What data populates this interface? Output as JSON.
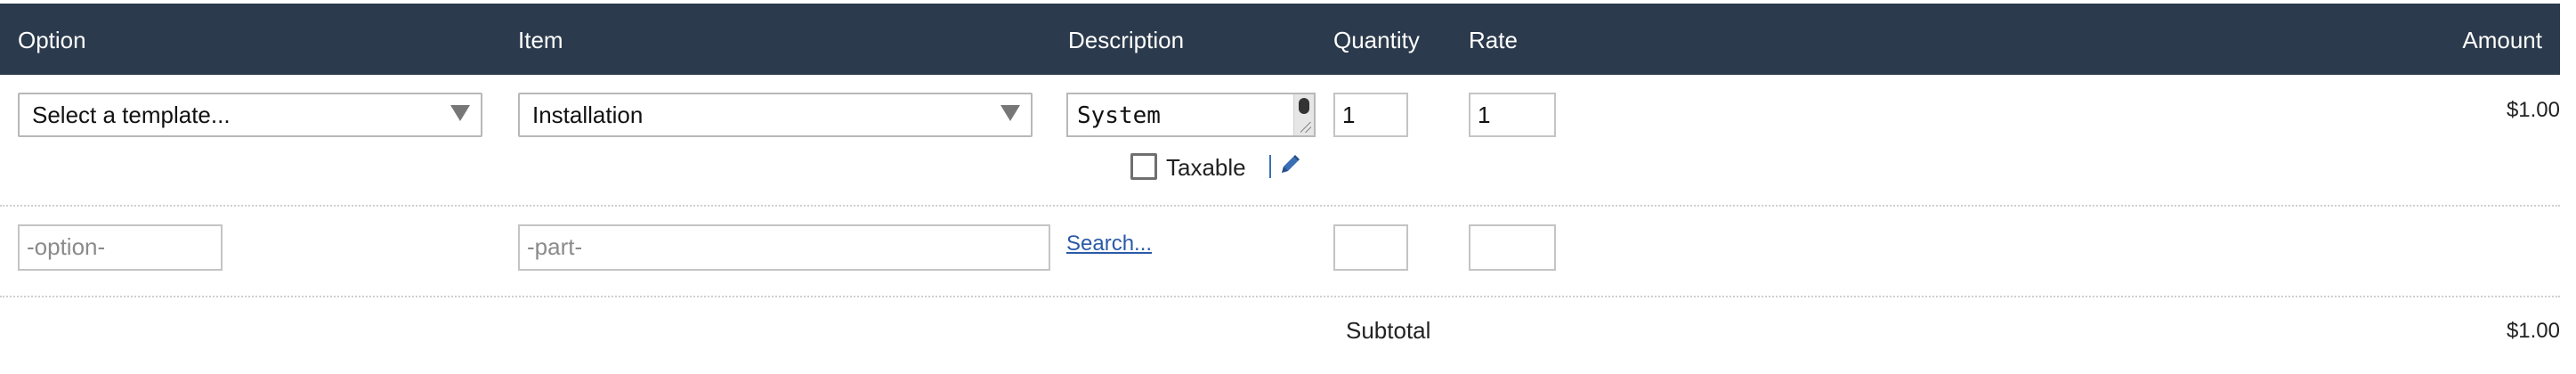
{
  "columns": {
    "option": "Option",
    "item": "Item",
    "description": "Description",
    "quantity": "Quantity",
    "rate": "Rate",
    "amount": "Amount"
  },
  "line_item": {
    "option_select": "Select a template...",
    "item_select": "Installation",
    "description_text": "System",
    "quantity": "1",
    "rate": "1",
    "taxable_label": "Taxable",
    "taxable_checked": false,
    "amount": "$1.00"
  },
  "new_line": {
    "option_placeholder": "-option-",
    "part_placeholder": "-part-",
    "search_link": "Search...",
    "quantity": "",
    "rate": ""
  },
  "totals": {
    "subtotal_label": "Subtotal",
    "subtotal_amount": "$1.00"
  },
  "icons": {
    "dropdown": "triangle-down-icon",
    "edit": "pencil-icon"
  },
  "colors": {
    "header_bg": "#2b3a4c",
    "link": "#2a5aa8",
    "edit_icon": "#3a6fb5"
  }
}
